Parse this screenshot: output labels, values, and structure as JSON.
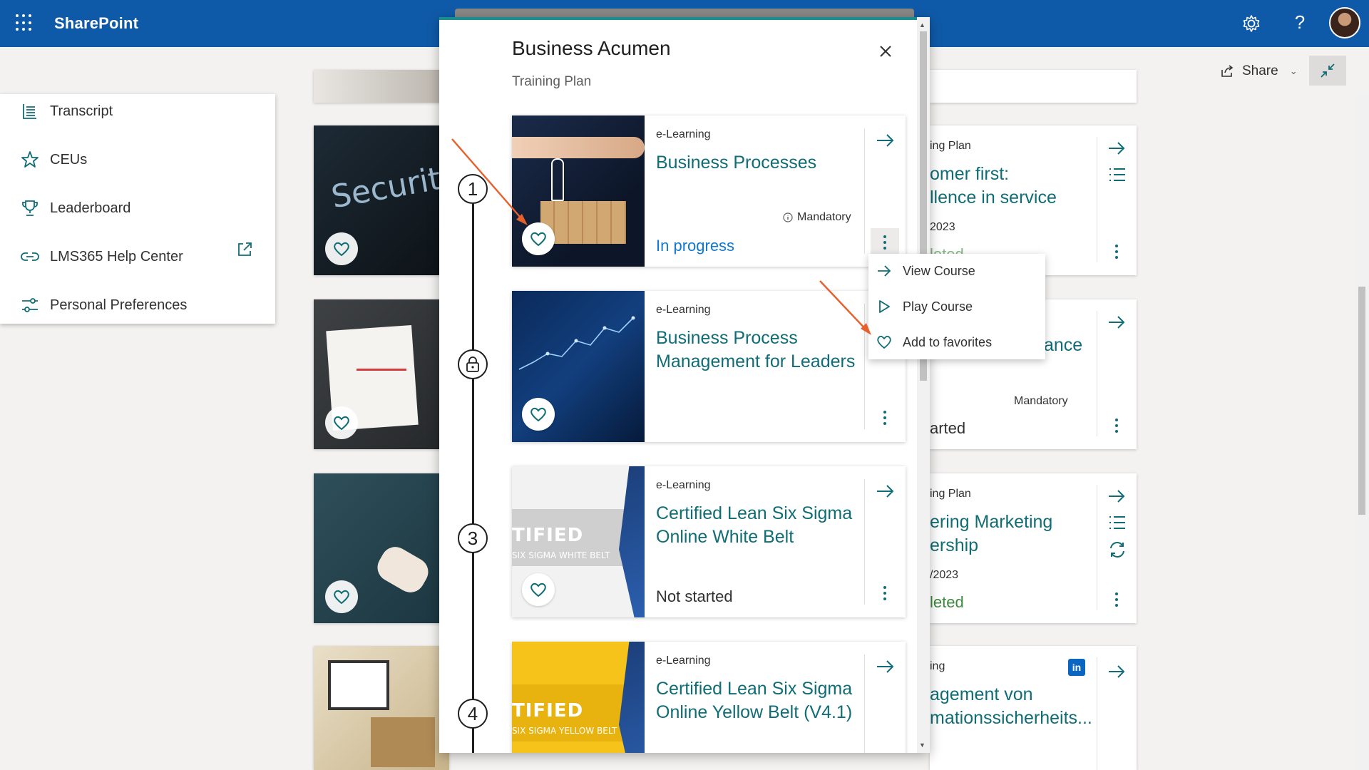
{
  "suitebar": {
    "app_title": "SharePoint",
    "icons": [
      "waffle-icon",
      "gear-icon",
      "help-icon"
    ],
    "help_glyph": "?"
  },
  "commandbar": {
    "share_label": "Share",
    "chevron": "⌄"
  },
  "leftnav": {
    "items": [
      {
        "label": "Transcript",
        "icon": "transcript-icon"
      },
      {
        "label": "CEUs",
        "icon": "star-icon"
      },
      {
        "label": "Leaderboard",
        "icon": "trophy-icon"
      },
      {
        "label": "LMS365 Help Center",
        "icon": "link-icon"
      },
      {
        "label": "Personal Preferences",
        "icon": "sliders-icon"
      }
    ]
  },
  "background_cards": [
    {
      "type": "ing Plan",
      "title_lines": [
        "omer first:",
        "llence in service"
      ],
      "date": "2023",
      "status": "leted"
    },
    {
      "title": "ance",
      "mandatory": "Mandatory",
      "status": "arted"
    },
    {
      "type": "ing Plan",
      "title_lines": [
        "ering Marketing",
        "ership"
      ],
      "date": "/2023",
      "status": "leted"
    },
    {
      "type": "ing",
      "title_lines": [
        "agement von",
        "mationssicherheits..."
      ]
    }
  ],
  "modal": {
    "title": "Business Acumen",
    "subtitle": "Training Plan",
    "steps": [
      "1",
      "lock",
      "3",
      "4"
    ],
    "courses": [
      {
        "type": "e-Learning",
        "title": "Business Processes",
        "mandatory": "Mandatory",
        "status": "In progress",
        "thumb_text": ""
      },
      {
        "type": "e-Learning",
        "title": "Business Process Management for Leaders",
        "mandatory": "",
        "status": "",
        "thumb_text": ""
      },
      {
        "type": "e-Learning",
        "title": "Certified Lean Six Sigma Online White Belt",
        "mandatory": "",
        "status": "Not started",
        "thumb_big": "TIFIED",
        "thumb_small": "SIX SIGMA WHITE BELT"
      },
      {
        "type": "e-Learning",
        "title": "Certified Lean Six Sigma Online Yellow Belt (V4.1)",
        "mandatory": "",
        "status": "",
        "thumb_big": "TIFIED",
        "thumb_small": "SIX SIGMA YELLOW BELT"
      }
    ]
  },
  "context_menu": {
    "items": [
      {
        "label": "View Course",
        "icon": "arrow-right-icon"
      },
      {
        "label": "Play Course",
        "icon": "play-icon"
      },
      {
        "label": "Add to favorites",
        "icon": "heart-icon"
      }
    ]
  },
  "background_thumb_text": "Security",
  "colors": {
    "suitebar": "#0f5aa8",
    "accent_teal": "#106d75",
    "progress_blue": "#0f78d4",
    "completed_green": "#3c8a3c",
    "annotation_orange": "#e8612c"
  }
}
